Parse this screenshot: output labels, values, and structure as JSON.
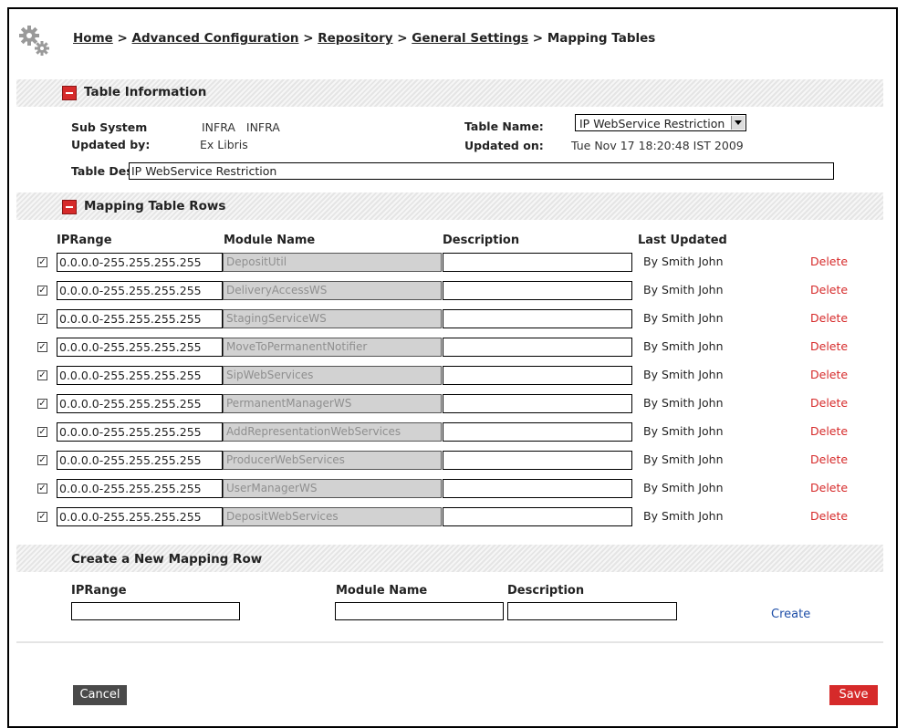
{
  "breadcrumb": {
    "items": [
      "Home",
      "Advanced Configuration",
      "Repository",
      "General Settings"
    ],
    "current": "Mapping Tables",
    "separator": ">"
  },
  "table_info": {
    "section_title": "Table Information",
    "sub_system_label": "Sub System",
    "sub_system_value": "INFRA   INFRA",
    "updated_by_label": "Updated by:",
    "updated_by_value": "Ex Libris",
    "table_name_label": "Table Name:",
    "table_name_value": "IP WebService Restriction",
    "updated_on_label": "Updated on:",
    "updated_on_value": "Tue Nov 17 18:20:48 IST 2009",
    "table_description_label": "Table Description:",
    "table_description_value": "IP WebService Restriction"
  },
  "mapping_rows": {
    "section_title": "Mapping Table Rows",
    "columns": [
      "IPRange",
      "Module Name",
      "Description",
      "Last Updated"
    ],
    "rows": [
      {
        "checked": true,
        "ip": "0.0.0.0-255.255.255.255",
        "module": "DepositUtil",
        "description": "",
        "updated": "By Smith John",
        "delete": "Delete"
      },
      {
        "checked": true,
        "ip": "0.0.0.0-255.255.255.255",
        "module": "DeliveryAccessWS",
        "description": "",
        "updated": "By Smith John",
        "delete": "Delete"
      },
      {
        "checked": true,
        "ip": "0.0.0.0-255.255.255.255",
        "module": "StagingServiceWS",
        "description": "",
        "updated": "By Smith John",
        "delete": "Delete"
      },
      {
        "checked": true,
        "ip": "0.0.0.0-255.255.255.255",
        "module": "MoveToPermanentNotifier",
        "description": "",
        "updated": "By Smith John",
        "delete": "Delete"
      },
      {
        "checked": true,
        "ip": "0.0.0.0-255.255.255.255",
        "module": "SipWebServices",
        "description": "",
        "updated": "By Smith John",
        "delete": "Delete"
      },
      {
        "checked": true,
        "ip": "0.0.0.0-255.255.255.255",
        "module": "PermanentManagerWS",
        "description": "",
        "updated": "By Smith John",
        "delete": "Delete"
      },
      {
        "checked": true,
        "ip": "0.0.0.0-255.255.255.255",
        "module": "AddRepresentationWebServices",
        "description": "",
        "updated": "By Smith John",
        "delete": "Delete"
      },
      {
        "checked": true,
        "ip": "0.0.0.0-255.255.255.255",
        "module": "ProducerWebServices",
        "description": "",
        "updated": "By Smith John",
        "delete": "Delete"
      },
      {
        "checked": true,
        "ip": "0.0.0.0-255.255.255.255",
        "module": "UserManagerWS",
        "description": "",
        "updated": "By Smith John",
        "delete": "Delete"
      },
      {
        "checked": true,
        "ip": "0.0.0.0-255.255.255.255",
        "module": "DepositWebServices",
        "description": "",
        "updated": "By Smith John",
        "delete": "Delete"
      }
    ]
  },
  "new_row": {
    "section_title": "Create a New Mapping Row",
    "ip_label": "IPRange",
    "module_label": "Module Name",
    "description_label": "Description",
    "create_label": "Create"
  },
  "footer": {
    "cancel_label": "Cancel",
    "save_label": "Save"
  },
  "colors": {
    "accent_red": "#d62a2a",
    "link_blue": "#1f4fa8",
    "cancel_dark": "#4a4a4a",
    "readonly_gray": "#d2d2d2"
  },
  "icons": {
    "header": "gear-icon",
    "section_toggle": "collapse-icon"
  }
}
